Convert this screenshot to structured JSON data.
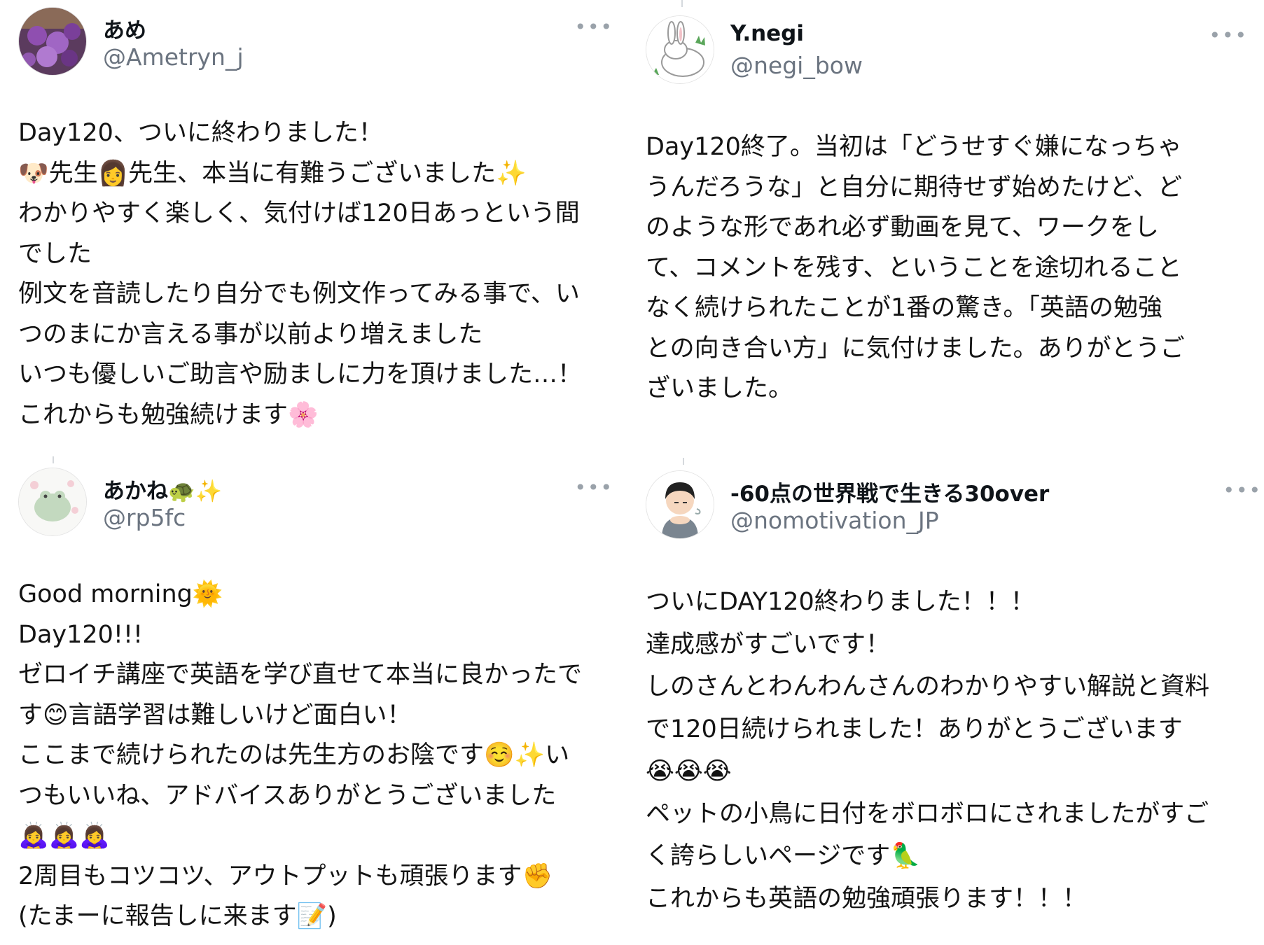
{
  "tweets": [
    {
      "name": "あめ",
      "handle": "@Ametryn_j",
      "more": "•••",
      "lines": [
        "Day120、ついに終わりました！",
        "🐶先生👩先生、本当に有難うございました✨",
        "わかりやすく楽しく、気付けば120日あっという間",
        "でした",
        "例文を音読したり自分でも例文作ってみる事で、い",
        "つのまにか言える事が以前より増えました",
        "いつも優しいご助言や励ましに力を頂けました…！",
        "これからも勉強続けます🌸"
      ]
    },
    {
      "name": "Y.negi",
      "handle": "@negi_bow",
      "more": "•••",
      "lines": [
        "Day120終了。当初は「どうせすぐ嫌になっちゃ",
        "うんだろうな」と自分に期待せず始めたけど、ど",
        "のような形であれ必ず動画を見て、ワークをし",
        "て、コメントを残す、ということを途切れること",
        "なく続けられたことが1番の驚き。「英語の勉強",
        "との向き合い方」に気付けました。ありがとうご",
        "ざいました。"
      ]
    },
    {
      "name": "あかね🐢✨",
      "handle": "@rp5fc",
      "more": "•••",
      "lines": [
        "Good morning🌞",
        "Day120!!!",
        "ゼロイチ講座で英語を学び直せて本当に良かったで",
        "す😊言語学習は難しいけど面白い！",
        "ここまで続けられたのは先生方のお陰です☺️✨い",
        "つもいいね、アドバイスありがとうございました",
        "🙇‍♀️🙇‍♀️🙇‍♀️",
        "2周目もコツコツ、アウトプットも頑張ります✊",
        "(たまーに報告しに来ます📝)"
      ]
    },
    {
      "name": "-60点の世界戦で生きる30over",
      "handle": "@nomotivation_JP",
      "more": "•••",
      "lines": [
        "ついにDAY120終わりました！！！",
        "達成感がすごいです！",
        "しのさんとわんわんさんのわかりやすい解説と資料",
        "で120日続けられました！ありがとうございます",
        "😭😭😭",
        "ペットの小鳥に日付をボロボロにされましたがすご",
        "く誇らしいページです🦜",
        "これからも英語の勉強頑張ります！！！"
      ]
    }
  ],
  "icons": {
    "avatar_1": "purple-flower-photo-avatar",
    "avatar_2": "white-rabbit-illustration-avatar",
    "avatar_3": "green-frog-illustration-avatar",
    "avatar_4": "tired-person-illustration-avatar",
    "more": "more-options-icon"
  },
  "colors": {
    "name": "#0f1419",
    "handle": "#6b7480",
    "text": "#141414",
    "more": "#9aa2aa"
  }
}
